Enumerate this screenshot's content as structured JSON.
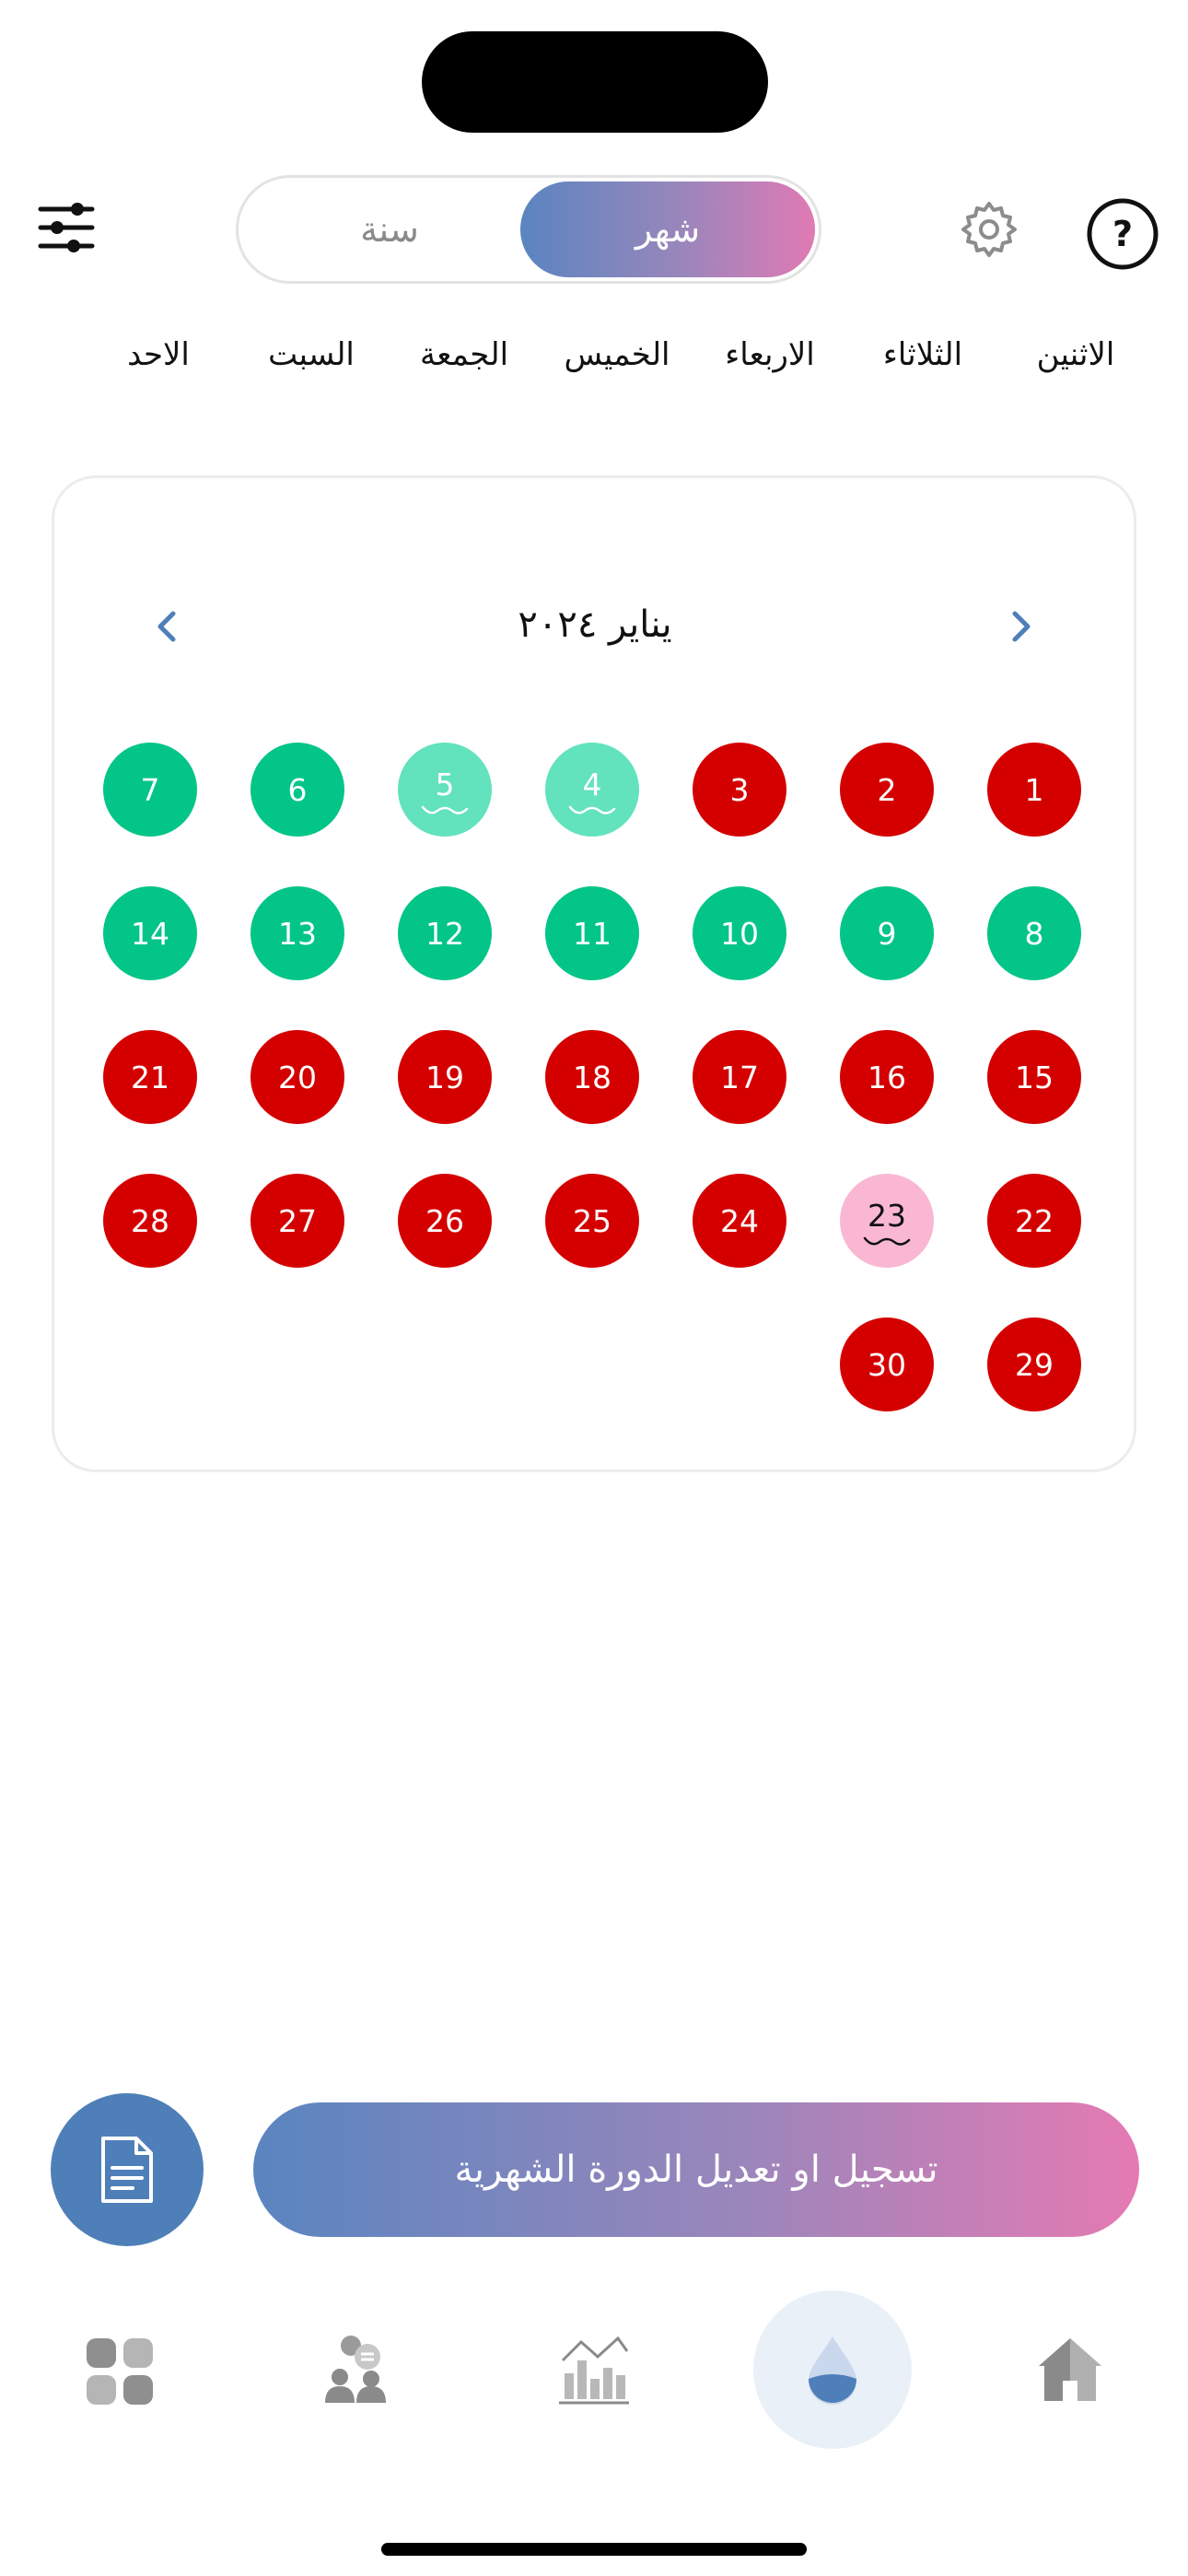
{
  "header": {
    "segments": {
      "year": "سنة",
      "month": "شهر"
    },
    "selected_segment": "month"
  },
  "weekdays": [
    "الاثنين",
    "الثلاثاء",
    "الاربعاء",
    "الخميس",
    "الجمعة",
    "السبت",
    "الاحد"
  ],
  "calendar": {
    "month_title": "يناير ٢٠٢٤",
    "days": [
      {
        "n": "1",
        "status": "red"
      },
      {
        "n": "2",
        "status": "red"
      },
      {
        "n": "3",
        "status": "red"
      },
      {
        "n": "4",
        "status": "mint",
        "wave": true
      },
      {
        "n": "5",
        "status": "mint",
        "wave": true
      },
      {
        "n": "6",
        "status": "green"
      },
      {
        "n": "7",
        "status": "green"
      },
      {
        "n": "8",
        "status": "green"
      },
      {
        "n": "9",
        "status": "green"
      },
      {
        "n": "10",
        "status": "green"
      },
      {
        "n": "11",
        "status": "green"
      },
      {
        "n": "12",
        "status": "green"
      },
      {
        "n": "13",
        "status": "green"
      },
      {
        "n": "14",
        "status": "green"
      },
      {
        "n": "15",
        "status": "red"
      },
      {
        "n": "16",
        "status": "red"
      },
      {
        "n": "17",
        "status": "red"
      },
      {
        "n": "18",
        "status": "red"
      },
      {
        "n": "19",
        "status": "red"
      },
      {
        "n": "20",
        "status": "red"
      },
      {
        "n": "21",
        "status": "red"
      },
      {
        "n": "22",
        "status": "red"
      },
      {
        "n": "23",
        "status": "pink",
        "wave": true
      },
      {
        "n": "24",
        "status": "red"
      },
      {
        "n": "25",
        "status": "red"
      },
      {
        "n": "26",
        "status": "red"
      },
      {
        "n": "27",
        "status": "red"
      },
      {
        "n": "28",
        "status": "red"
      },
      {
        "n": "29",
        "status": "red"
      },
      {
        "n": "30",
        "status": "red"
      }
    ]
  },
  "actions": {
    "primary_label": "تسجيل او تعديل الدورة الشهرية"
  },
  "colors": {
    "red": "#d40000",
    "green": "#03c587",
    "mint": "#62e2bd",
    "pink": "#fab7d3",
    "accent_blue": "#4f7fb9",
    "accent_pink": "#e07ab4"
  },
  "icons": {
    "filter": "sliders-icon",
    "settings": "gear-icon",
    "help": "question-circle-icon",
    "document": "document-icon",
    "tabs": [
      "grid-icon",
      "community-icon",
      "stats-icon",
      "drop-icon",
      "home-icon"
    ]
  }
}
